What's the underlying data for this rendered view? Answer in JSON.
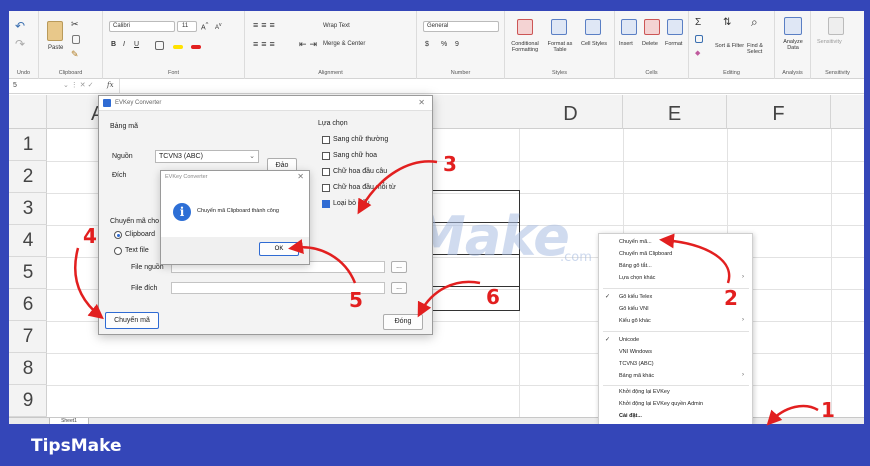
{
  "ribbon": {
    "undo_label": "Undo",
    "clipboard": {
      "label": "Clipboard",
      "paste": "Paste"
    },
    "font": {
      "label": "Font",
      "name": "Calibri",
      "size": "11",
      "bold": "B",
      "italic": "I",
      "underline": "U"
    },
    "alignment": {
      "label": "Alignment",
      "wrap": "Wrap Text",
      "merge": "Merge & Center"
    },
    "number": {
      "label": "Number",
      "format": "General",
      "currency": "$",
      "percent": "%",
      "comma": "9"
    },
    "styles": {
      "label": "Styles",
      "cond": "Conditional Formatting",
      "table": "Format as Table",
      "cell": "Cell Styles"
    },
    "cells": {
      "label": "Cells",
      "insert": "Insert",
      "delete": "Delete",
      "format": "Format"
    },
    "editing": {
      "label": "Editing",
      "sort": "Sort & Filter",
      "find": "Find & Select"
    },
    "analysis": {
      "label": "Analysis",
      "analyze": "Analyze Data"
    },
    "sensitivity": {
      "label": "Sensitivity",
      "btn": "Sensitivity"
    }
  },
  "formula_bar": {
    "cell_ref": "5",
    "fx": "fx"
  },
  "columns": [
    "A",
    "D",
    "E",
    "F"
  ],
  "rows": [
    "1",
    "2",
    "3",
    "4",
    "5",
    "6",
    "7",
    "8",
    "9"
  ],
  "sheet_tab": "Sheet1",
  "evkey": {
    "title": "EVKey Converter",
    "close": "✕",
    "bang_ma": "Bảng mã",
    "nguon": "Nguồn",
    "nguon_value": "TCVN3 (ABC)",
    "dich": "Đích",
    "dao": "Đảo",
    "lua_chon": "Lựa chọn",
    "options": [
      "Sang chữ thường",
      "Sang chữ hoa",
      "Chữ hoa đầu câu",
      "Chữ hoa đầu mỗi từ",
      "Loại bỏ dấu"
    ],
    "chuyen_ma_cho": "Chuyển mã cho",
    "clipboard": "Clipboard",
    "text_file": "Text file",
    "file_nguon": "File nguồn",
    "file_dich": "File đích",
    "browse": "...",
    "convert_btn": "Chuyển mã",
    "close_btn": "Đóng"
  },
  "message": {
    "title": "EVKey Converter",
    "icon": "i",
    "text": "Chuyển mã Clipboard thành công",
    "ok": "OK"
  },
  "context_menu": {
    "items": [
      {
        "label": "Chuyển mã...",
        "check": "",
        "arrow": ""
      },
      {
        "label": "Chuyển mã Clipboard",
        "check": "",
        "arrow": ""
      },
      {
        "label": "Bảng gõ tắt...",
        "check": "",
        "arrow": ""
      },
      {
        "label": "Lựa chọn khác",
        "check": "",
        "arrow": "›"
      },
      {
        "label": "Gõ kiểu Telex",
        "check": "✓",
        "arrow": ""
      },
      {
        "label": "Gõ kiểu VNI",
        "check": "",
        "arrow": ""
      },
      {
        "label": "Kiểu gõ khác",
        "check": "",
        "arrow": "›"
      },
      {
        "label": "Unicode",
        "check": "✓",
        "arrow": ""
      },
      {
        "label": "VNI Windows",
        "check": "",
        "arrow": ""
      },
      {
        "label": "TCVN3 (ABC)",
        "check": "",
        "arrow": ""
      },
      {
        "label": "Bảng mã khác",
        "check": "",
        "arrow": "›"
      },
      {
        "label": "Khởi động lại EVKey",
        "check": "",
        "arrow": ""
      },
      {
        "label": "Khởi động lại EVKey quyền Admin",
        "check": "",
        "arrow": ""
      },
      {
        "label": "Cài đặt...",
        "check": "",
        "arrow": ""
      }
    ]
  },
  "annotations": [
    "1",
    "2",
    "3",
    "4",
    "5",
    "6"
  ],
  "watermark": {
    "text": "TipsMake",
    "suffix": ".com"
  },
  "banner": {
    "brand": "TipsMake"
  },
  "colors": {
    "frame": "#3446b8",
    "annotation": "#e21f1f",
    "accent": "#2f6bd3"
  }
}
